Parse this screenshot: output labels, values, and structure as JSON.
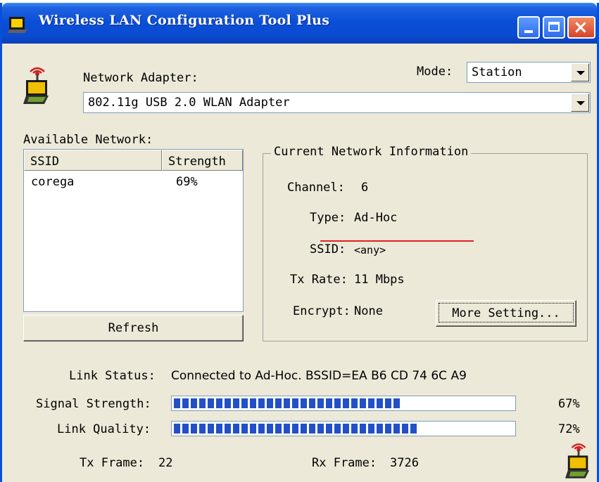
{
  "window": {
    "title": "Wireless LAN Configuration Tool Plus"
  },
  "adapter": {
    "label": "Network Adapter:",
    "selected": "802.11g USB 2.0 WLAN Adapter"
  },
  "mode": {
    "label": "Mode:",
    "selected": "Station"
  },
  "available": {
    "label": "Available Network:",
    "columns": [
      "SSID",
      "Strength"
    ],
    "rows": [
      {
        "ssid": "corega",
        "strength": "69%"
      }
    ],
    "refresh_label": "Refresh"
  },
  "current": {
    "legend": "Current Network Information",
    "channel_label": "Channel:",
    "channel": "6",
    "type_label": "Type:",
    "type": "Ad-Hoc",
    "ssid_label": "SSID:",
    "ssid": "<any>",
    "rate_label": "Tx Rate:",
    "rate": "11 Mbps",
    "encrypt_label": "Encrypt:",
    "encrypt": "None",
    "more_label": "More Setting..."
  },
  "status": {
    "link_label": "Link Status:",
    "link": "Connected to Ad-Hoc. BSSID=EA B6 CD 74 6C A9",
    "signal_label": "Signal Strength:",
    "signal_value": 0.67,
    "signal_text": "67%",
    "quality_label": "Link Quality:",
    "quality_value": 0.72,
    "quality_text": "72%",
    "tx_label": "Tx Frame:",
    "tx": "22",
    "rx_label": "Rx Frame:",
    "rx": "3726"
  },
  "colors": {
    "titlebar": "#0a4fd8",
    "progress_fill": "#2150c8",
    "annotation": "#e02020",
    "dialog_bg": "#ece9d8"
  },
  "icons": [
    "wireless-adapter-icon",
    "minimize-icon",
    "maximize-icon",
    "close-icon",
    "dropdown-arrow-icon"
  ]
}
